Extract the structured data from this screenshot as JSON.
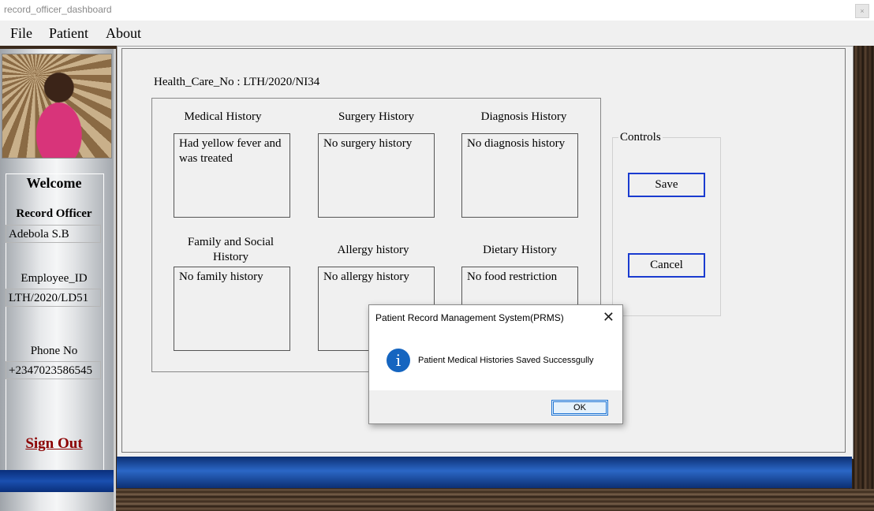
{
  "window": {
    "title": "record_officer_dashboard",
    "control_glyph": "×"
  },
  "menu": {
    "file": "File",
    "patient": "Patient",
    "about": "About"
  },
  "sidebar": {
    "welcome": "Welcome",
    "role": "Record Officer",
    "name": "Adebola S.B",
    "employee_id_label": "Employee_ID",
    "employee_id": "LTH/2020/LD51",
    "phone_label": "Phone No",
    "phone": "+2347023586545",
    "sign_out": "Sign Out"
  },
  "main": {
    "health_care_label": "Health_Care_No :",
    "health_care_no": "LTH/2020/NI34",
    "histories": {
      "medical": {
        "label": "Medical History",
        "value": "Had yellow fever and was treated"
      },
      "surgery": {
        "label": "Surgery History",
        "value": "No surgery history"
      },
      "diagnosis": {
        "label": "Diagnosis History",
        "value": "No diagnosis history"
      },
      "family": {
        "label": "Family and Social History",
        "value": "No family history"
      },
      "allergy": {
        "label": "Allergy history",
        "value": "No allergy history"
      },
      "dietary": {
        "label": "Dietary History",
        "value": "No food restriction"
      }
    },
    "controls": {
      "label": "Controls",
      "save": "Save",
      "cancel": "Cancel"
    }
  },
  "dialog": {
    "title": "Patient Record Management System(PRMS)",
    "close": "✕",
    "icon": "i",
    "message": "Patient Medical Histories Saved Successgully",
    "ok": "OK"
  }
}
